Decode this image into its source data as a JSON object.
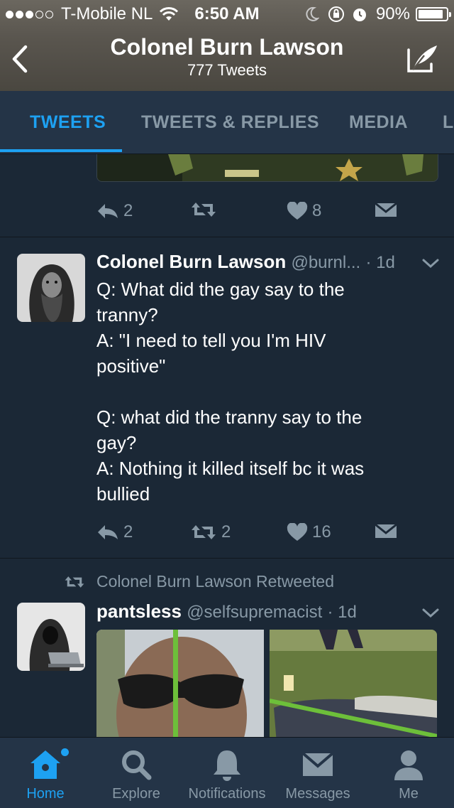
{
  "status_bar": {
    "carrier": "T-Mobile NL",
    "time": "6:50 AM",
    "battery": "90%",
    "battery_level": 0.9
  },
  "header": {
    "title": "Colonel Burn Lawson",
    "subtitle": "777 Tweets"
  },
  "tabs": [
    {
      "label": "TWEETS",
      "active": true
    },
    {
      "label": "TWEETS & REPLIES",
      "active": false
    },
    {
      "label": "MEDIA",
      "active": false
    },
    {
      "label": "L",
      "active": false
    }
  ],
  "colors": {
    "background": "#1b2836",
    "bar": "#243447",
    "accent": "#1da1f2",
    "muted": "#8899a6"
  },
  "tweets": [
    {
      "reply_count": "2",
      "retweet_count": "",
      "like_count": "8"
    },
    {
      "name": "Colonel Burn Lawson",
      "handle": "@burnl...",
      "time": "· 1d",
      "text": "Q: What did the gay say to the\ntranny?\nA: \"I need to tell you I'm HIV\npositive\"\n\nQ: what did the tranny say to the\ngay?\nA: Nothing it killed itself bc it was\nbullied",
      "reply_count": "2",
      "retweet_count": "2",
      "like_count": "16"
    },
    {
      "retweeted_by": "Colonel Burn Lawson Retweeted",
      "name": "pantsless",
      "handle": "@selfsupremacist",
      "time": "· 1d"
    }
  ],
  "bottom_nav": [
    {
      "label": "Home",
      "icon": "home-icon",
      "active": true
    },
    {
      "label": "Explore",
      "icon": "search-icon",
      "active": false
    },
    {
      "label": "Notifications",
      "icon": "bell-icon",
      "active": false
    },
    {
      "label": "Messages",
      "icon": "envelope-icon",
      "active": false
    },
    {
      "label": "Me",
      "icon": "person-icon",
      "active": false
    }
  ]
}
